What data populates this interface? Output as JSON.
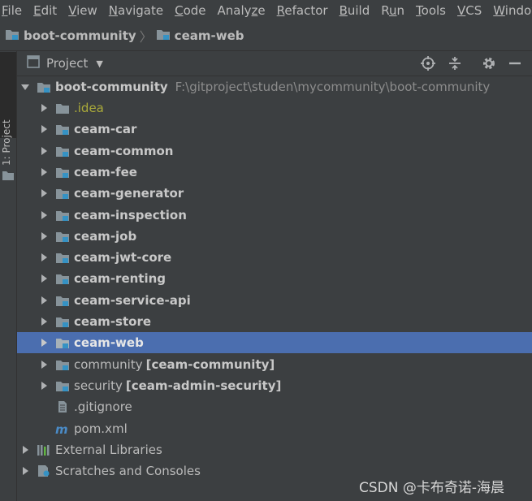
{
  "menubar": {
    "items": [
      {
        "mn": "F",
        "rest": "ile"
      },
      {
        "mn": "E",
        "rest": "dit"
      },
      {
        "mn": "V",
        "rest": "iew"
      },
      {
        "mn": "N",
        "rest": "avigate"
      },
      {
        "mn": "C",
        "rest": "ode"
      },
      {
        "pre": "Analy",
        "mn": "z",
        "rest": "e"
      },
      {
        "mn": "R",
        "rest": "efactor"
      },
      {
        "mn": "B",
        "rest": "uild"
      },
      {
        "pre": "R",
        "mn": "u",
        "rest": "n"
      },
      {
        "mn": "T",
        "rest": "ools"
      },
      {
        "mn": "V",
        "rest": "CS"
      },
      {
        "mn": "W",
        "rest": "indow"
      }
    ]
  },
  "breadcrumb": {
    "root": "boot-community",
    "child": "ceam-web"
  },
  "stripe": {
    "tab_label": "1: Project"
  },
  "panel": {
    "view_label": "Project"
  },
  "tree": {
    "root": {
      "label": "boot-community",
      "path": "F:\\gitproject\\studen\\mycommunity\\boot-community"
    },
    "modules": [
      {
        "label": ".idea",
        "style": "idea",
        "icon": "folder-icon"
      },
      {
        "label": "ceam-car",
        "style": "bold",
        "icon": "module-folder-icon"
      },
      {
        "label": "ceam-common",
        "style": "bold",
        "icon": "module-folder-icon"
      },
      {
        "label": "ceam-fee",
        "style": "bold",
        "icon": "module-folder-icon"
      },
      {
        "label": "ceam-generator",
        "style": "bold",
        "icon": "module-folder-icon"
      },
      {
        "label": "ceam-inspection",
        "style": "bold",
        "icon": "module-folder-icon"
      },
      {
        "label": "ceam-job",
        "style": "bold",
        "icon": "module-folder-icon"
      },
      {
        "label": "ceam-jwt-core",
        "style": "bold",
        "icon": "module-folder-icon"
      },
      {
        "label": "ceam-renting",
        "style": "bold",
        "icon": "module-folder-icon"
      },
      {
        "label": "ceam-service-api",
        "style": "bold",
        "icon": "module-folder-icon"
      },
      {
        "label": "ceam-store",
        "style": "bold",
        "icon": "module-folder-icon"
      },
      {
        "label": "ceam-web",
        "style": "bold",
        "icon": "module-folder-icon",
        "selected": true
      },
      {
        "label": "community",
        "bracket": "[ceam-community]",
        "style": "plain",
        "icon": "module-folder-icon"
      },
      {
        "label": "security",
        "bracket": "[ceam-admin-security]",
        "style": "plain",
        "icon": "module-folder-icon"
      }
    ],
    "files": [
      {
        "label": ".gitignore",
        "icon": "text-file-icon"
      },
      {
        "label": "pom.xml",
        "icon": "maven-icon"
      }
    ],
    "external_libraries": "External Libraries",
    "scratches": "Scratches and Consoles"
  },
  "watermark": "CSDN @卡布奇诺-海晨",
  "colors": {
    "background": "#3c3f41",
    "selection": "#4b6eaf",
    "module_badge": "#3592c4",
    "idea_text": "#aaaa3a"
  }
}
